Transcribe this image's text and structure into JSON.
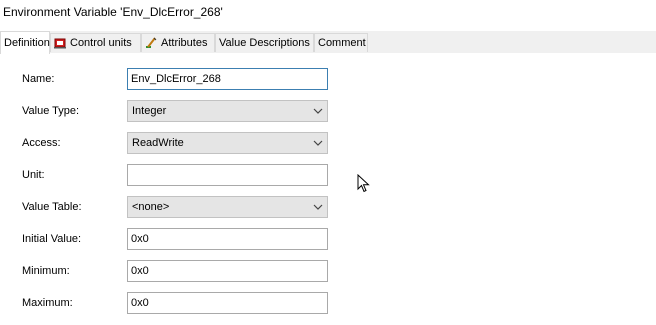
{
  "window": {
    "title": "Environment Variable 'Env_DlcError_268'"
  },
  "tabs": [
    {
      "label": "Definition",
      "active": true
    },
    {
      "label": "Control units",
      "icon": "control-units-icon"
    },
    {
      "label": "Attributes",
      "icon": "attributes-icon"
    },
    {
      "label": "Value Descriptions"
    },
    {
      "label": "Comment"
    }
  ],
  "form": {
    "name_label": "Name:",
    "name_value": "Env_DlcError_268",
    "value_type_label": "Value Type:",
    "value_type_value": "Integer",
    "access_label": "Access:",
    "access_value": "ReadWrite",
    "unit_label": "Unit:",
    "unit_value": "",
    "value_table_label": "Value Table:",
    "value_table_value": "<none>",
    "initial_value_label": "Initial Value:",
    "initial_value_value": "0x0",
    "minimum_label": "Minimum:",
    "minimum_value": "0x0",
    "maximum_label": "Maximum:",
    "maximum_value": "0x0"
  },
  "colors": {
    "focus_border": "#3c7fb1",
    "combo_bg": "#e5e5e5",
    "tab_bg": "#f0f0f0"
  }
}
